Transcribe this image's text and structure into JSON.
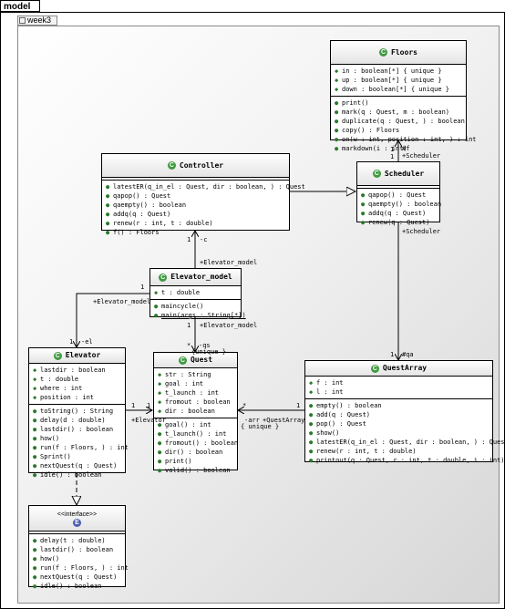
{
  "package": {
    "name": "model",
    "subpackage": "week3"
  },
  "classes": {
    "floors": {
      "name": "Floors",
      "attributes": [
        "in : boolean[*] { unique }",
        "up : boolean[*] { unique }",
        "down : boolean[*] { unique }"
      ],
      "operations": [
        "print()",
        "mark(q : Quest, m : boolean)",
        "duplicate(q : Quest, ) : boolean",
        "copy() : Floors",
        "on(w : int, position : int, ) : int",
        "markdown(i : int)"
      ]
    },
    "controller": {
      "name": "Controller",
      "operations": [
        "latestER(q_in_el : Quest, dir : boolean, ) : Quest",
        "qapop() : Quest",
        "qaempty() : boolean",
        "addq(q : Quest)",
        "renew(r : int, t : double)",
        "f() : Floors"
      ]
    },
    "scheduler": {
      "name": "Scheduler",
      "operations": [
        "qapop() : Quest",
        "qaempty() : boolean",
        "addq(q : Quest)",
        "renew(q : Quest)"
      ]
    },
    "elevator_model": {
      "name": "Elevator_model",
      "attributes": [
        "t : double"
      ],
      "operations": [
        "maincycle()",
        "main(args : String[*])"
      ]
    },
    "elevator": {
      "name": "Elevator",
      "attributes": [
        "lastdir : boolean",
        "t : double",
        "where : int",
        "position : int"
      ],
      "operations": [
        "toString() : String",
        "delay(d : double)",
        "lastdir() : boolean",
        "how()",
        "run(f : Floors, ) : int",
        "Sprint()",
        "nextQuest(q : Quest)",
        "idle() : boolean"
      ]
    },
    "quest": {
      "name": "Quest",
      "attributes": [
        "str : String",
        "goal : int",
        "t_launch : int",
        "fromout : boolean",
        "dir : boolean"
      ],
      "operations": [
        "goal() : int",
        "t_launch() : int",
        "fromout() : boolean",
        "dir() : boolean",
        "print()",
        "valid() : boolean"
      ]
    },
    "questarray": {
      "name": "QuestArray",
      "attributes": [
        "f : int",
        "l : int"
      ],
      "operations": [
        "empty() : boolean",
        "add(q : Quest)",
        "pop() : Quest",
        "show()",
        "latestER(q_in_el : Quest, dir : boolean, ) : Quest",
        "renew(r : int, t : double)",
        "printout(q : Quest, r : int, t : double, i : int)"
      ]
    },
    "e": {
      "stereotype": "<<interface>>",
      "name": "E",
      "operations": [
        "delay(t : double)",
        "lastdir() : boolean",
        "how()",
        "run(f : Floors, ) : int",
        "nextQuest(q : Quest)",
        "idle() : boolean"
      ]
    }
  },
  "edge_labels": {
    "sched_floors_mult1": "1",
    "sched_floors_mult2": "1",
    "sched_floors_role1": "+Scheduler",
    "sched_floors_role2": "#f",
    "sched_qa_role": "+Scheduler",
    "sched_qa_mult": "1",
    "sched_qa_role2": "#qa",
    "ctrl_em_mult": "1",
    "ctrl_em_role": "-c",
    "ctrl_em_role2": "+Elevator_model",
    "em_el_mult": "1",
    "em_el_role": "+Elevator_model",
    "em_el_mult2": "1",
    "em_el_role2": "-el",
    "em_q_mult": "1",
    "em_q_role": "+Elevator_model",
    "em_q_mult2": "*",
    "em_q_role2": "-qs",
    "em_q_unique": "{unique }",
    "el_q_mult": "1",
    "el_q_mult2": "1",
    "el_q_role": "+Elevator",
    "qa_q_mult": "1",
    "qa_q_mult2": "*",
    "qa_q_role": "+QuestArray",
    "qa_q_role2": "-arr",
    "qa_q_unique": "{ unique }"
  }
}
